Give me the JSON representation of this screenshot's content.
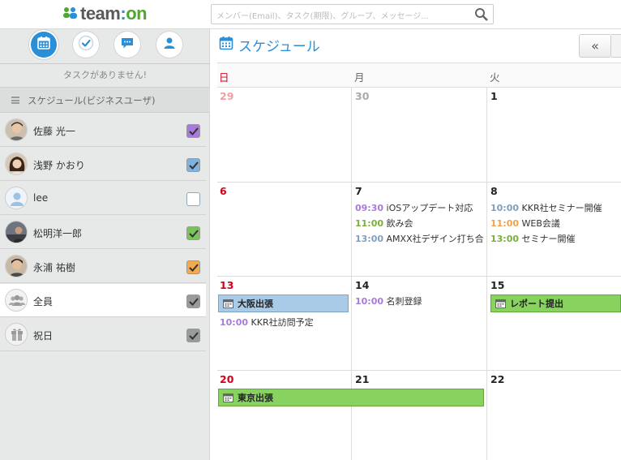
{
  "app": {
    "logo_text": "team:on",
    "logo_colors": {
      "team": "#5a5a5a",
      "on": "#4ea72e",
      "colon": "#2a8fd6"
    }
  },
  "search": {
    "placeholder": "メンバー(Email)、タスク(期限)、グループ、メッセージ..."
  },
  "sidebar": {
    "icons": [
      "calendar-icon",
      "check-icon",
      "chat-icon",
      "user-icon"
    ],
    "no_task": "タスクがありません!",
    "schedule_header": "スケジュール(ビジネスユーザ)",
    "users": [
      {
        "name": "佐藤 光一",
        "checked": true,
        "color": "#a77bdb"
      },
      {
        "name": "浅野 かおり",
        "checked": true,
        "color": "#7fb2dd"
      },
      {
        "name": "lee",
        "checked": false,
        "color": "#ffffff"
      },
      {
        "name": "松明洋一郎",
        "checked": true,
        "color": "#79c35a"
      },
      {
        "name": "永浦 祐樹",
        "checked": true,
        "color": "#f4a94f"
      },
      {
        "name": "全員",
        "checked": true,
        "color": "#9a9a9a"
      },
      {
        "name": "祝日",
        "checked": true,
        "color": "#9a9a9a"
      }
    ]
  },
  "main": {
    "title": "スケジュール",
    "prev_label": "«",
    "weekdays": [
      "日",
      "月",
      "火"
    ],
    "weeks": [
      {
        "days": [
          "29",
          "30",
          "1"
        ]
      },
      {
        "days": [
          "6",
          "7",
          "8"
        ]
      },
      {
        "days": [
          "13",
          "14",
          "15"
        ]
      },
      {
        "days": [
          "20",
          "21",
          "22"
        ]
      }
    ],
    "events": {
      "mon7": [
        {
          "time": "09:30",
          "title": "iOSアップデート対応",
          "color": "#a77bdb"
        },
        {
          "time": "11:00",
          "title": "飲み会",
          "color": "#79b03a"
        },
        {
          "time": "13:00",
          "title": "AMXX社デザイン打ち合",
          "color": "#7f9fbf"
        }
      ],
      "tue8": [
        {
          "time": "10:00",
          "title": "KKR社セミナー開催",
          "color": "#7f9fbf"
        },
        {
          "time": "11:00",
          "title": "WEB会議",
          "color": "#f0a34a"
        },
        {
          "time": "13:00",
          "title": "セミナー開催",
          "color": "#79b03a"
        }
      ],
      "sun13": [
        {
          "time": "10:00",
          "title": "KKR社訪問予定",
          "color": "#a77bdb"
        }
      ],
      "mon14": [
        {
          "time": "10:00",
          "title": "名刺登録",
          "color": "#a77bdb"
        }
      ],
      "bars": [
        {
          "title": "大阪出張",
          "color": "#a9cbe8"
        },
        {
          "title": "レポート提出",
          "color": "#88d35f"
        },
        {
          "title": "東京出張",
          "color": "#88d35f"
        }
      ]
    }
  },
  "colors": {
    "accent": "#2a8fd6",
    "sunday": "#d0021b",
    "muted_date": "#aaaaaa",
    "sunday_muted": "#f0a0a0"
  }
}
